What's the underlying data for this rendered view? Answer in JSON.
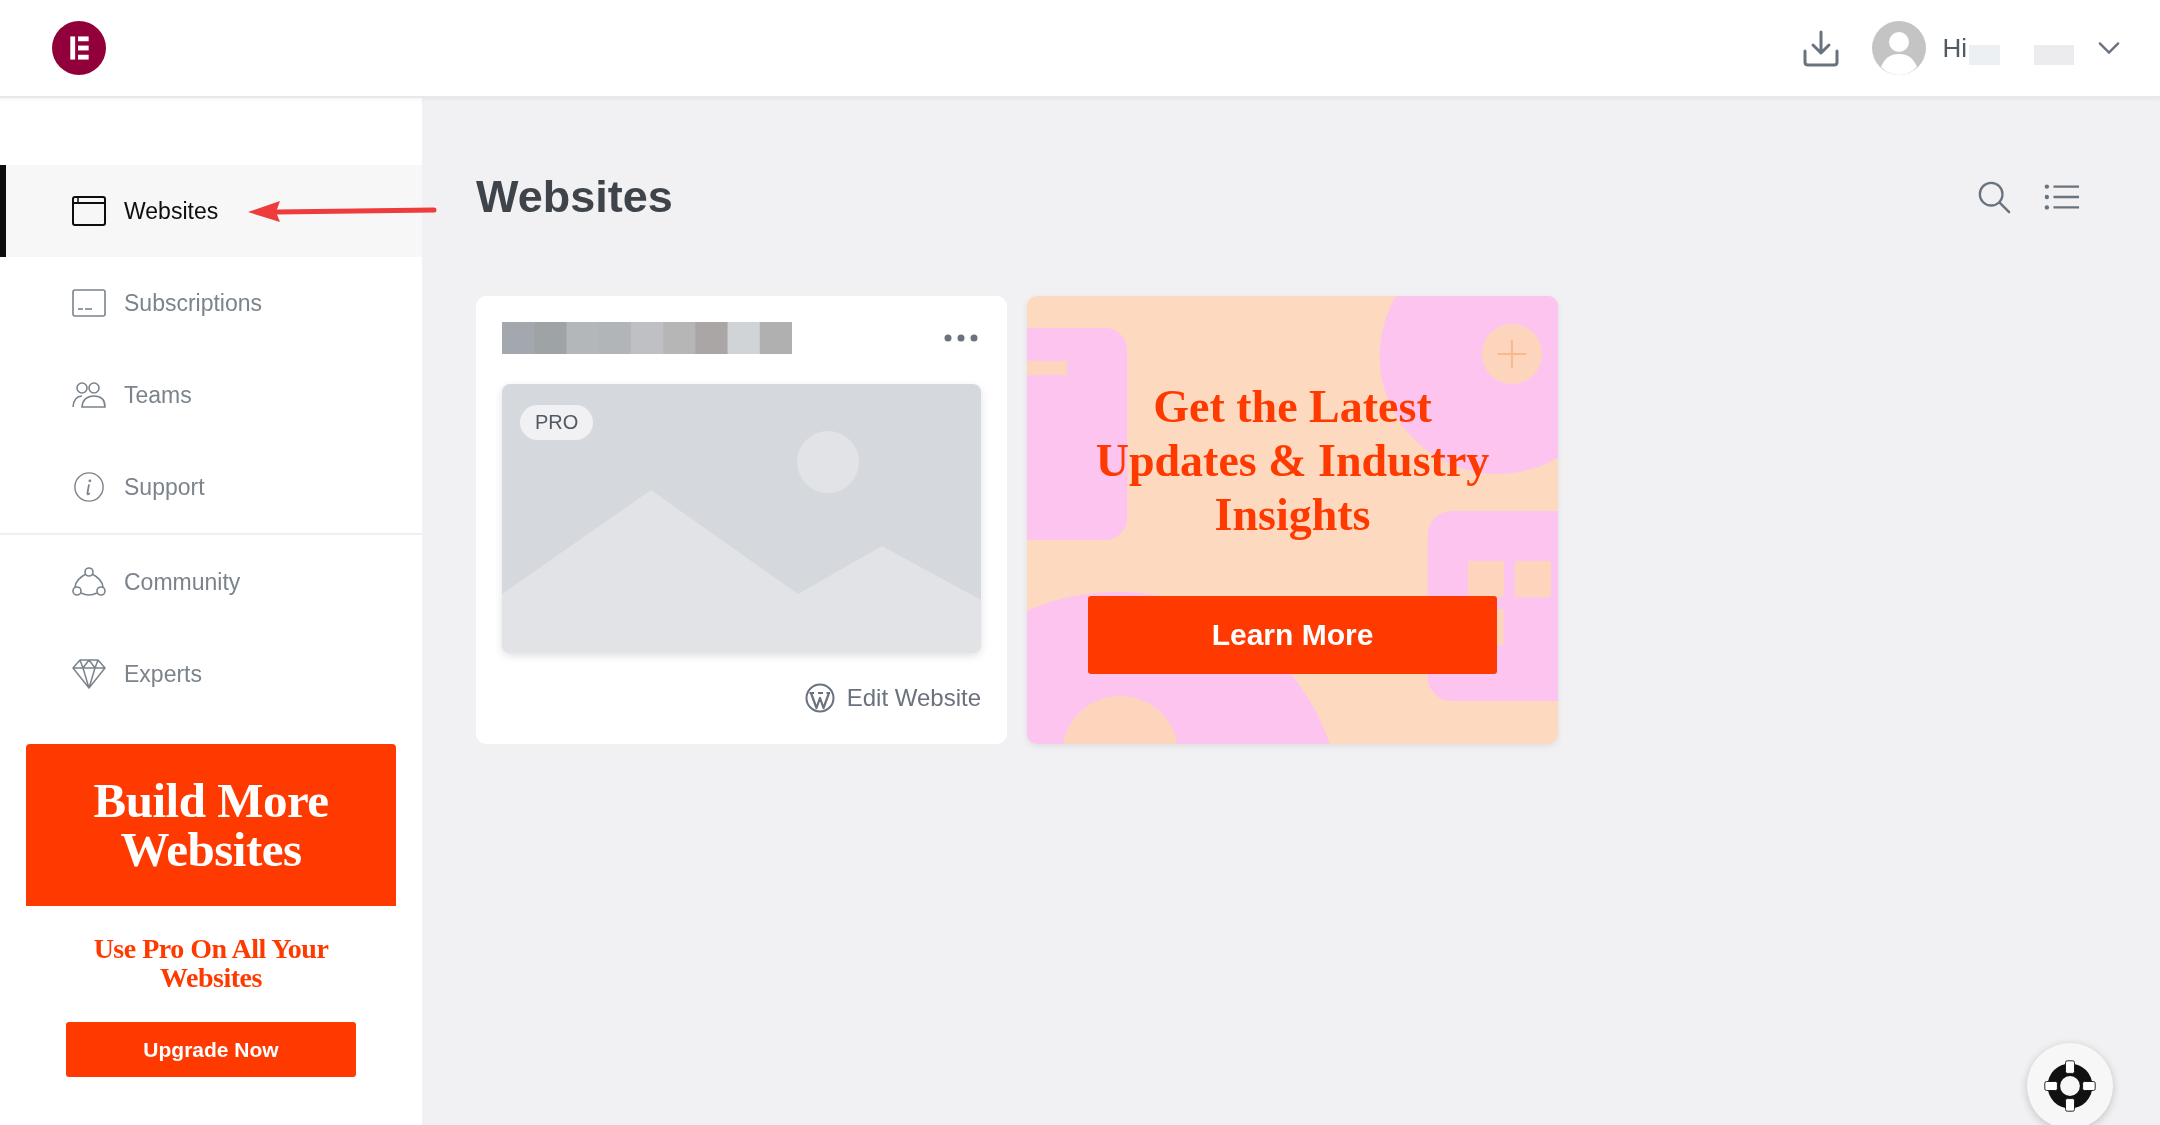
{
  "header": {
    "greeting": "Hi"
  },
  "sidebar": {
    "main_items": [
      {
        "label": "Websites",
        "selected": true
      },
      {
        "label": "Subscriptions",
        "selected": false
      },
      {
        "label": "Teams",
        "selected": false
      },
      {
        "label": "Support",
        "selected": false
      }
    ],
    "secondary_items": [
      {
        "label": "Community",
        "selected": false
      },
      {
        "label": "Experts",
        "selected": false
      }
    ],
    "promo": {
      "title": "Build More Websites",
      "subtitle": "Use Pro On All Your Websites",
      "button": "Upgrade Now"
    }
  },
  "page": {
    "title": "Websites"
  },
  "website_card": {
    "badge": "PRO",
    "action": "Edit Website"
  },
  "ad_card": {
    "title": "Get the Latest Updates & Industry Insights",
    "button": "Learn More"
  }
}
